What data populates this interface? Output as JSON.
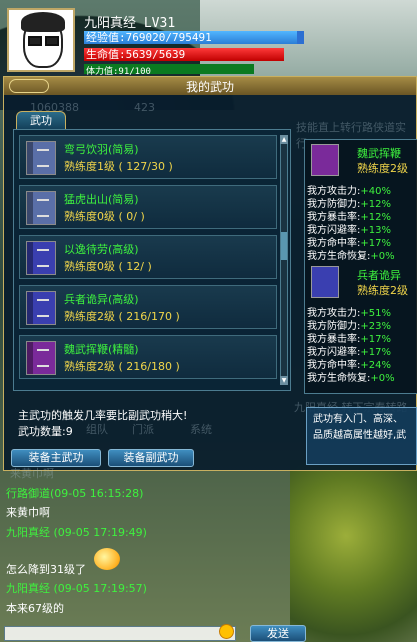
{
  "character": {
    "name": "九阳真经",
    "level": "LV31",
    "exp_label": "经验值:",
    "exp_value": "769020/795491",
    "exp_fraction": 0.967,
    "hp_label": "生命值:",
    "hp_value": "5639/5639",
    "hp_fraction": 1.0,
    "mp_label": "体力值:",
    "mp_value": "91/100",
    "mp_fraction": 0.91
  },
  "panel": {
    "title": "我的武功",
    "tab_label": "武功",
    "faded_texts": {
      "a": "1060388",
      "b": "423",
      "c": "技能直上转行路侠道实行",
      "d": "组队",
      "e": "门派",
      "f": "系统",
      "g": "九阳真经 转下宗春转路",
      "h": "来黄巾啊"
    },
    "skills": [
      {
        "name": "弯弓饮羽(简易)",
        "prof": "熟练度1级 ( 127/30 )"
      },
      {
        "name": "猛虎出山(简易)",
        "prof": "熟练度0级 ( 0/ )"
      },
      {
        "name": "以逸待劳(高级)",
        "prof": "熟练度0级 ( 12/ )"
      },
      {
        "name": "兵者诡异(高级)",
        "prof": "熟练度2级 ( 216/170 )"
      },
      {
        "name": "魏武挥鞭(精髓)",
        "prof": "熟练度2级 ( 216/180 )"
      }
    ],
    "equipped": [
      {
        "name": "魏武挥鞭",
        "prof": "熟练度2级",
        "stats": [
          {
            "label": "我方攻击力:",
            "value": "+40%"
          },
          {
            "label": "我方防御力:",
            "value": "+12%"
          },
          {
            "label": "我方暴击率:",
            "value": "+12%"
          },
          {
            "label": "我方闪避率:",
            "value": "+13%"
          },
          {
            "label": "我方命中率:",
            "value": "+17%"
          },
          {
            "label": "我方生命恢复:",
            "value": "+0%"
          }
        ]
      },
      {
        "name": "兵者诡异",
        "prof": "熟练度2级",
        "stats": [
          {
            "label": "我方攻击力:",
            "value": "+51%"
          },
          {
            "label": "我方防御力:",
            "value": "+23%"
          },
          {
            "label": "我方暴击率:",
            "value": "+17%"
          },
          {
            "label": "我方闪避率:",
            "value": "+17%"
          },
          {
            "label": "我方命中率:",
            "value": "+24%"
          },
          {
            "label": "我方生命恢复:",
            "value": "+0%"
          }
        ]
      }
    ],
    "hint": "主武功的触发几率要比副武功稍大!",
    "count": "武功数量:9",
    "equip_main_label": "装备主武功",
    "equip_sub_label": "装备副武功",
    "tooltip": "武功有入门、高深、品质越高属性越好,武"
  },
  "chat": {
    "lines": [
      {
        "type": "name",
        "text": "行路御道(09-05 16:15:28)"
      },
      {
        "type": "msg",
        "text": "来黄巾啊"
      },
      {
        "type": "name",
        "text": "九阳真经 (09-05 17:19:49)"
      },
      {
        "type": "msg",
        "text": "怎么降到31级了"
      },
      {
        "type": "name",
        "text": "九阳真经 (09-05 17:19:57)"
      },
      {
        "type": "msg",
        "text": "本来67级的"
      }
    ],
    "send_label": "发送"
  },
  "colors": {
    "skill_name": "#3ef23e",
    "proficiency": "#f0d54a",
    "accent_gold": "#c8b060"
  }
}
